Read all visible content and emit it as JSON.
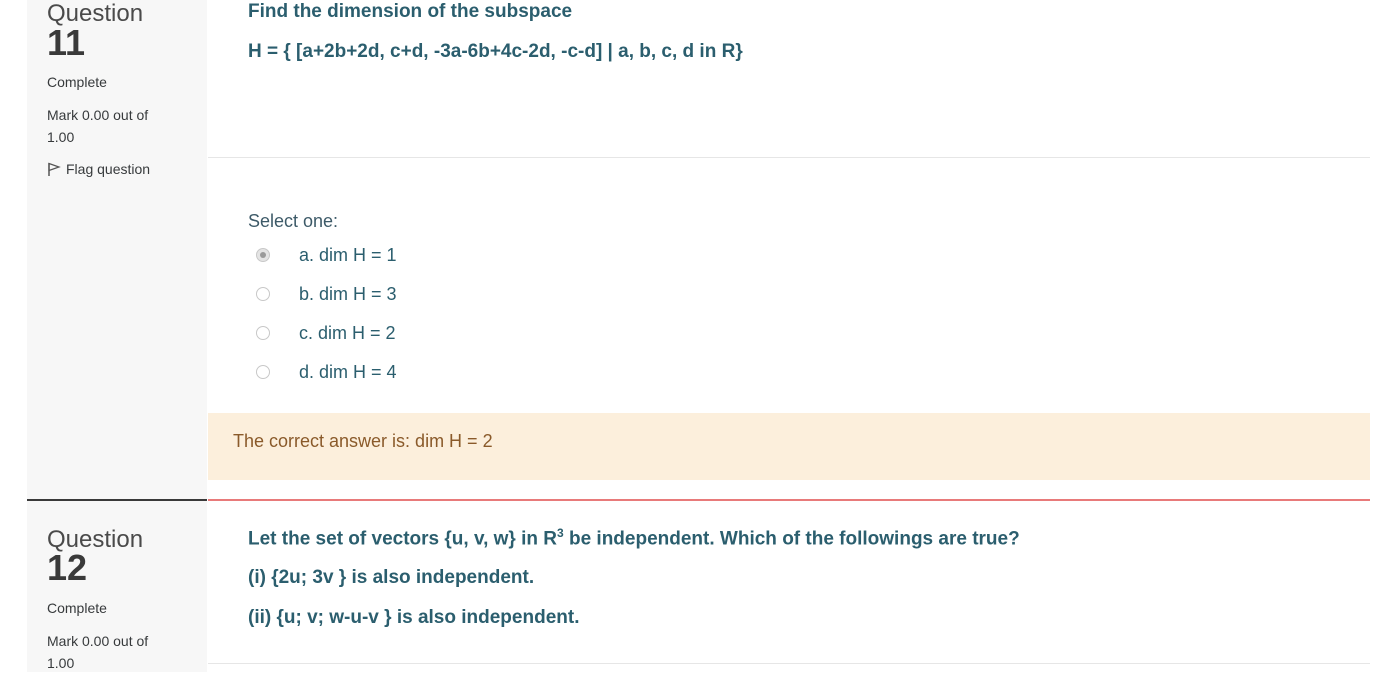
{
  "q11": {
    "label": "Question",
    "number": "11",
    "state": "Complete",
    "mark": "Mark 0.00 out of 1.00",
    "flag_label": "Flag question",
    "title": "Find the dimension of the subspace",
    "formula": "H = { [a+2b+2d, c+d, -3a-6b+4c-2d, -c-d] | a, b, c, d in R}",
    "select_label": "Select one:",
    "options": [
      {
        "label": "a. dim H = 1",
        "checked": true
      },
      {
        "label": "b. dim H = 3",
        "checked": false
      },
      {
        "label": "c. dim H = 2",
        "checked": false
      },
      {
        "label": "d. dim H = 4",
        "checked": false
      }
    ],
    "feedback": "The correct answer is: dim H = 2"
  },
  "q12": {
    "label": "Question",
    "number": "12",
    "state": "Complete",
    "mark": "Mark 0.00 out of 1.00",
    "line1_pre": "Let the set of vectors {u, v, w} in R",
    "line1_sup": "3",
    "line1_post": " be independent. Which of the followings are true?",
    "line2": "(i) {2u; 3v } is also independent.",
    "line3": "(ii) {u; v; w-u-v } is also independent."
  }
}
